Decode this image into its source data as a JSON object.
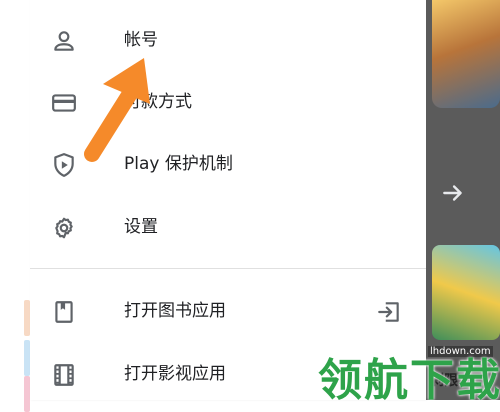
{
  "menu": {
    "items": [
      {
        "label": "帐号",
        "icon": "account-icon"
      },
      {
        "label": "付款方式",
        "icon": "payment-card-icon"
      },
      {
        "label": "Play 保护机制",
        "icon": "play-protect-icon"
      },
      {
        "label": "设置",
        "icon": "settings-gear-icon"
      },
      {
        "label": "打开图书应用",
        "icon": "books-icon",
        "trailing_icon": "open-external-icon"
      },
      {
        "label": "打开影视应用",
        "icon": "movies-film-icon"
      }
    ]
  },
  "background": {
    "bottom_text": "剁限"
  },
  "watermark": {
    "text": "领航下载",
    "url": "lhdown.com"
  },
  "colors": {
    "pointer_arrow": "#f58a2a",
    "watermark_green": "#2ea34a",
    "icon_gray": "#5f6368",
    "text": "#202124"
  }
}
